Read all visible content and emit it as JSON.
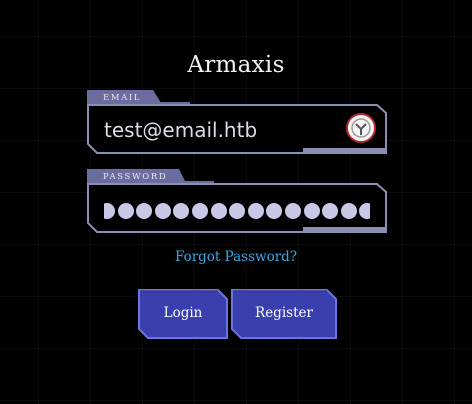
{
  "app": {
    "title": "Armaxis"
  },
  "email": {
    "label": "EMAIL",
    "value": "test@email.htb",
    "icon": "password-manager-icon"
  },
  "password": {
    "label": "PASSWORD",
    "masked_char_count": 15
  },
  "links": {
    "forgot_password": "Forgot Password?"
  },
  "buttons": {
    "login": "Login",
    "register": "Register"
  },
  "colors": {
    "background": "#000000",
    "label_bg": "#6a6d9e",
    "field_border": "#8c8fb4",
    "button_bg": "#3a3fae",
    "button_border": "#6e72dc",
    "link": "#3fa7e6"
  }
}
